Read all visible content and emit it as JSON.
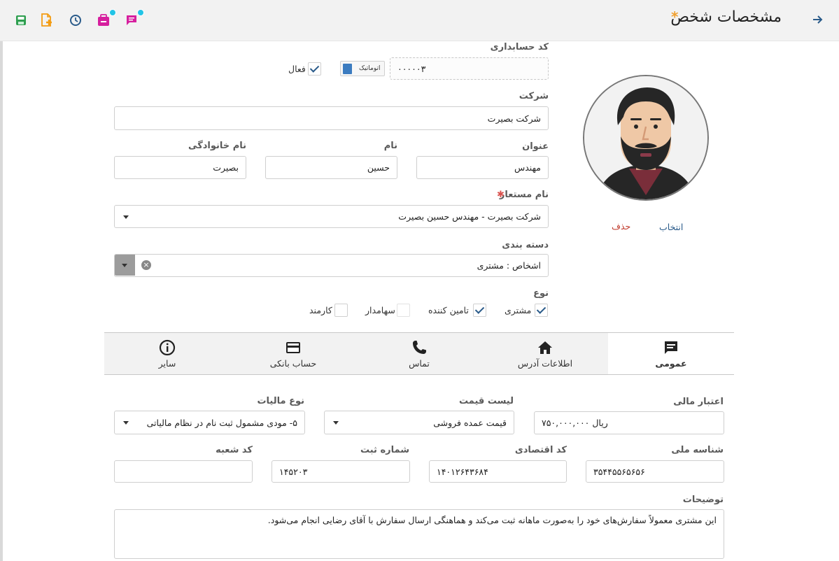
{
  "header": {
    "title": "مشخصات شخص",
    "dirty_marker": "*"
  },
  "toolbar": {
    "icons": [
      "save-icon",
      "add-document-icon",
      "history-icon",
      "tasks-icon",
      "messages-icon"
    ]
  },
  "accounting": {
    "label": "کد حسابداری",
    "code": "۰۰۰۰۰۳",
    "auto_label": "اتوماتیک",
    "active_label": "فعال",
    "active": true
  },
  "company": {
    "label": "شرکت",
    "value": "شرکت بصیرت"
  },
  "name": {
    "title_label": "عنوان",
    "title_value": "مهندس",
    "first_label": "نام",
    "first_value": "حسین",
    "last_label": "نام خانوادگی",
    "last_value": "بصیرت"
  },
  "alias": {
    "label": "نام مستعار",
    "required_mark": "✱",
    "value": "شرکت بصیرت - مهندس حسین بصیرت"
  },
  "category": {
    "label": "دسته بندی",
    "value": "اشخاص : مشتری"
  },
  "type": {
    "label": "نوع",
    "options": [
      {
        "label": "مشتری",
        "checked": true
      },
      {
        "label": "تامین کننده",
        "checked": true
      },
      {
        "label": "سهامدار",
        "checked": false
      },
      {
        "label": "کارمند",
        "checked": false
      }
    ]
  },
  "photo": {
    "select_label": "انتخاب",
    "delete_label": "حذف"
  },
  "tabs": [
    {
      "label": "عمومی",
      "icon": "comment-icon",
      "active": true
    },
    {
      "label": "اطلاعات آدرس",
      "icon": "home-icon",
      "active": false
    },
    {
      "label": "تماس",
      "icon": "phone-icon",
      "active": false
    },
    {
      "label": "حساب بانکی",
      "icon": "credit-card-icon",
      "active": false
    },
    {
      "label": "سایر",
      "icon": "info-icon",
      "active": false
    }
  ],
  "general": {
    "credit_label": "اعتبار مالی",
    "credit_value": "ریال ۷۵۰,۰۰۰,۰۰۰",
    "pricelist_label": "لیست قیمت",
    "pricelist_value": "قیمت عمده فروشی",
    "tax_label": "نوع مالیات",
    "tax_value": "۵- مودی مشمول ثبت نام در نظام مالیاتی",
    "national_id_label": "شناسه ملی",
    "national_id_value": "۳۵۴۴۵۵۶۵۶۵۶",
    "economic_code_label": "کد اقتصادی",
    "economic_code_value": "۱۴۰۱۲۶۴۳۶۸۴",
    "reg_no_label": "شماره ثبت",
    "reg_no_value": "۱۴۵۲۰۳",
    "branch_label": "کد شعبه",
    "branch_value": "",
    "notes_label": "توضیحات",
    "notes_value": "این مشتری معمولاً سفارش‌های خود را به‌صورت ماهانه ثبت می‌کند و هماهنگی ارسال سفارش با آقای رضایی انجام می‌شود."
  },
  "colors": {
    "accent": "#2a5b8a",
    "delete": "#c0392b",
    "required": "#d9534f",
    "badge": "#22c4e6"
  }
}
